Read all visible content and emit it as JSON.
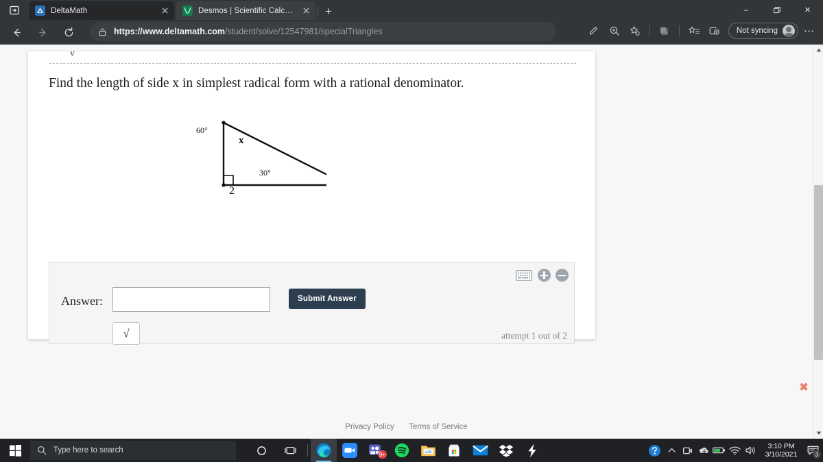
{
  "browser": {
    "tabs": [
      {
        "title": "DeltaMath",
        "favicon": "deltamath-icon",
        "active": true
      },
      {
        "title": "Desmos | Scientific Calculator",
        "favicon": "desmos-icon",
        "active": false
      }
    ],
    "new_tab_label": "+",
    "window_controls": {
      "minimize": "–",
      "maximize": "❐",
      "close": "✕"
    },
    "nav": {
      "back": "←",
      "forward": "→",
      "reload": "⟳"
    },
    "url": {
      "scheme": "https://www.deltamath.com",
      "path": "/student/solve/12547981/specialTriangles",
      "full": "https://www.deltamath.com/student/solve/12547981/specialTriangles"
    },
    "sync_label": "Not syncing",
    "toolbar_icons": [
      "pen-icon",
      "zoom-in-icon",
      "favorite-star-icon",
      "collections-icon",
      "favorites-list-icon",
      "browser-essentials-icon"
    ],
    "more_label": "⋯"
  },
  "page": {
    "stray_glyph": "y",
    "prompt": "Find the length of side x in simplest radical form with a rational denominator.",
    "figure": {
      "angle_top": "60°",
      "side_hypotenuse": "x",
      "angle_bottom_right": "30°",
      "side_base": "2",
      "right_angle_marker": true
    },
    "answer": {
      "label": "Answer:",
      "value": "",
      "placeholder": "",
      "submit_label": "Submit Answer",
      "sqrt_label": "√",
      "attempt_text": "attempt 1 out of 2",
      "keyboard_icon": "keyboard-icon",
      "zoom_in_icon": "plus-circle-icon",
      "zoom_out_icon": "minus-circle-icon"
    },
    "footer": {
      "privacy": "Privacy Policy",
      "terms": "Terms of Service"
    },
    "close_x": "✖"
  },
  "taskbar": {
    "start_label": "start-icon",
    "search_placeholder": "Type here to search",
    "cortana_label": "cortana-icon",
    "taskview_label": "task-view-icon",
    "apps": [
      {
        "name": "edge-icon",
        "running": true
      },
      {
        "name": "zoom-icon",
        "running": false
      },
      {
        "name": "teams-icon",
        "running": false,
        "badge": "9+"
      },
      {
        "name": "spotify-icon",
        "running": false
      },
      {
        "name": "file-explorer-icon",
        "running": false
      },
      {
        "name": "microsoft-store-icon",
        "running": false
      },
      {
        "name": "mail-icon",
        "running": false
      },
      {
        "name": "dropbox-icon",
        "running": false
      },
      {
        "name": "lightning-app-icon",
        "running": false
      }
    ],
    "tray": {
      "help_icon": "help-circle-icon",
      "chevron": "∧",
      "icons": [
        "camera-icon",
        "onedrive-icon",
        "battery-icon",
        "wifi-icon",
        "volume-icon"
      ],
      "time": "3:10 PM",
      "date": "3/10/2021",
      "notification_badge": "3"
    }
  },
  "colors": {
    "chrome_bg": "#323639",
    "submit_button": "#2c3e50",
    "answer_panel": "#f5f5f5",
    "close_x": "#e8836e",
    "taskbar": "#1f2125"
  }
}
